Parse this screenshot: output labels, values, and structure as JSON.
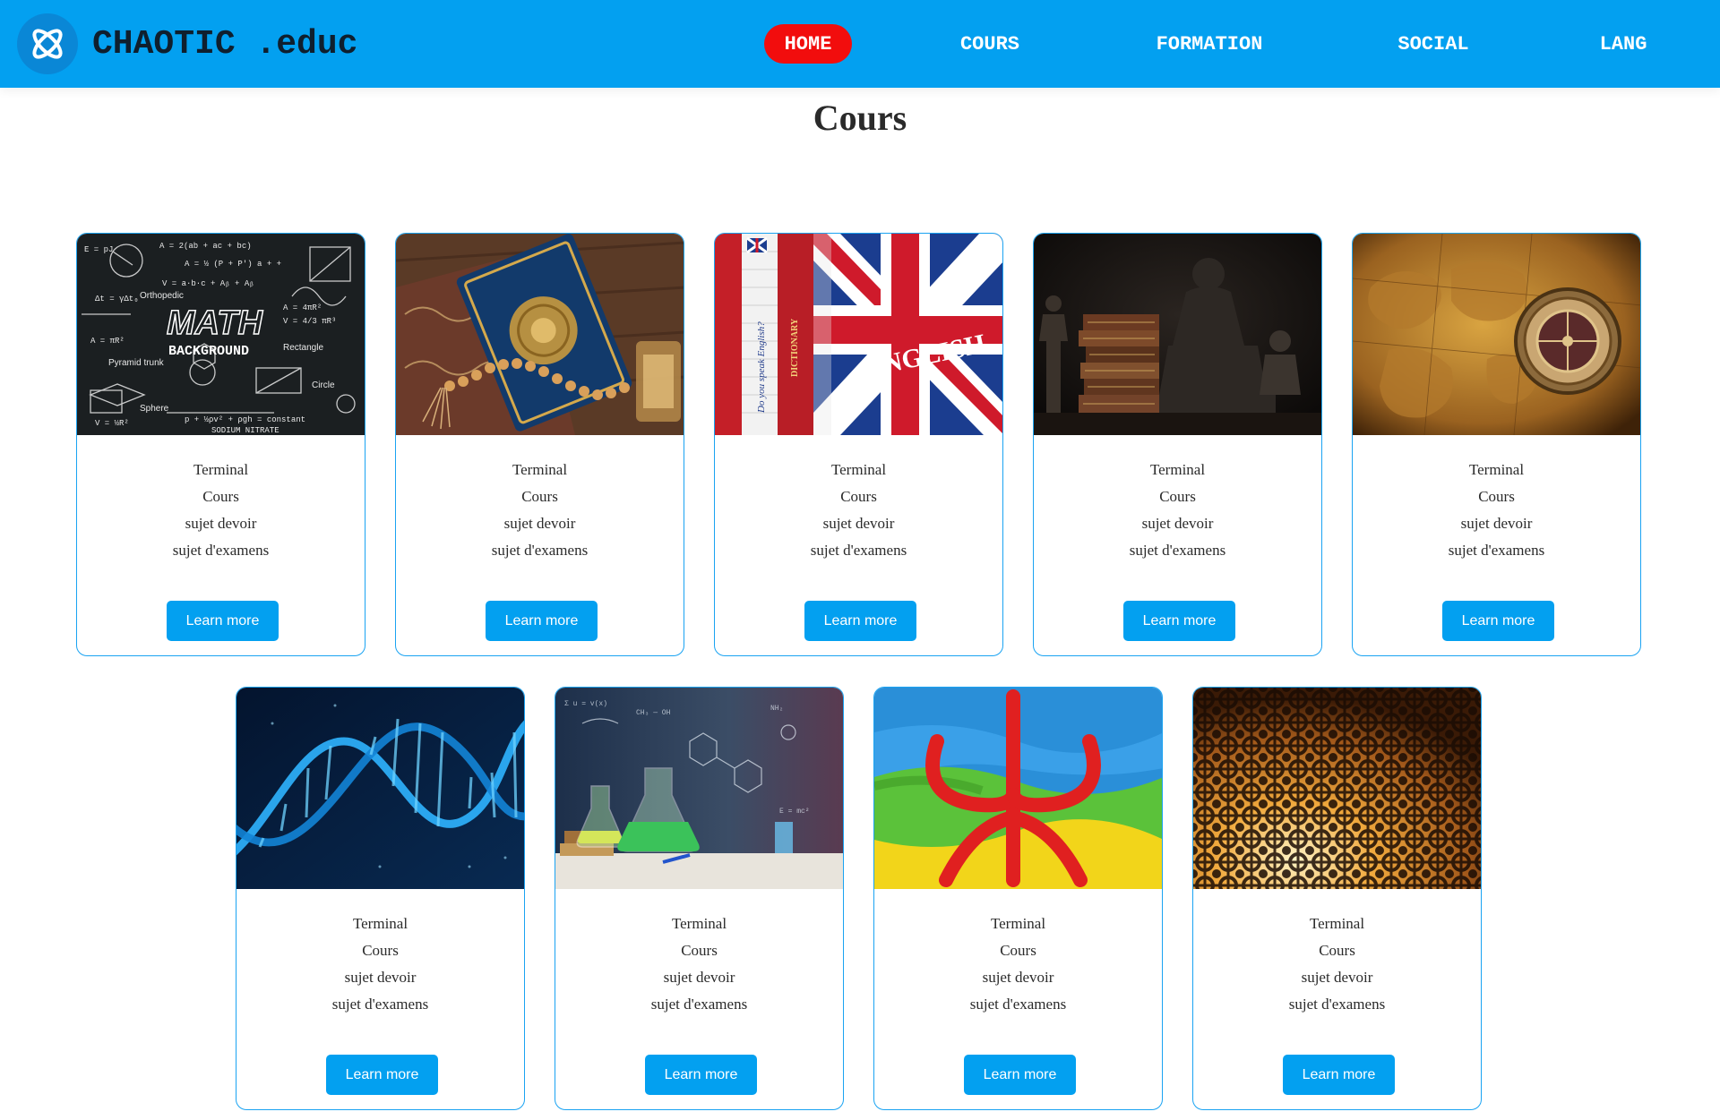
{
  "header": {
    "brand": "CHAOTIC .educ",
    "nav": [
      "HOME",
      "COURS",
      "FORMATION",
      "SOCIAL",
      "LANG"
    ],
    "active": "HOME"
  },
  "page": {
    "title": "Cours"
  },
  "cards": [
    {
      "subject": "math",
      "lines": [
        "Terminal",
        "Cours",
        "sujet devoir",
        "sujet d'examens"
      ],
      "button": "Learn more"
    },
    {
      "subject": "islamic-studies",
      "lines": [
        "Terminal",
        "Cours",
        "sujet devoir",
        "sujet d'examens"
      ],
      "button": "Learn more"
    },
    {
      "subject": "english",
      "lines": [
        "Terminal",
        "Cours",
        "sujet devoir",
        "sujet d'examens"
      ],
      "button": "Learn more"
    },
    {
      "subject": "philosophy",
      "lines": [
        "Terminal",
        "Cours",
        "sujet devoir",
        "sujet d'examens"
      ],
      "button": "Learn more"
    },
    {
      "subject": "history-geography",
      "lines": [
        "Terminal",
        "Cours",
        "sujet devoir",
        "sujet d'examens"
      ],
      "button": "Learn more"
    },
    {
      "subject": "biology",
      "lines": [
        "Terminal",
        "Cours",
        "sujet devoir",
        "sujet d'examens"
      ],
      "button": "Learn more"
    },
    {
      "subject": "chemistry",
      "lines": [
        "Terminal",
        "Cours",
        "sujet devoir",
        "sujet d'examens"
      ],
      "button": "Learn more"
    },
    {
      "subject": "amazigh",
      "lines": [
        "Terminal",
        "Cours",
        "sujet devoir",
        "sujet d'examens"
      ],
      "button": "Learn more"
    },
    {
      "subject": "arabic",
      "lines": [
        "Terminal",
        "Cours",
        "sujet devoir",
        "sujet d'examens"
      ],
      "button": "Learn more"
    }
  ],
  "images": {
    "math": {
      "text_1": "MATH",
      "text_2": "BACKGROUND",
      "text_3": "Orthopedic",
      "text_4": "Rectangle",
      "text_5": "Circle",
      "text_6": "Sphere",
      "text_7": "Pyramid trunk"
    },
    "english": {
      "text_1": "ENGLISH",
      "text_2": "DICTIONARY",
      "text_3": "Do you speak English?"
    }
  },
  "colors": {
    "header_bg": "#03a0f0",
    "active_nav": "#f20d0d",
    "button_bg": "#03a0f0",
    "card_border": "#1aa3f2"
  },
  "icons": {
    "logo": "atom-knot-icon"
  }
}
